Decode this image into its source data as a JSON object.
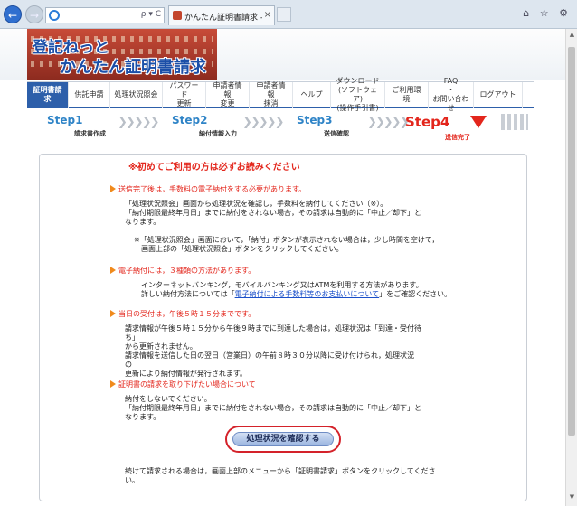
{
  "browser": {
    "tab_title": "かんたん証明書請求 - 送信...",
    "close_glyph": "×",
    "right_icons": "⌂ ☆ ⚙",
    "back_glyph": "←",
    "fwd_glyph": "→",
    "addr_tools": "ρ ▾ C"
  },
  "header": {
    "logo_line1": "登記ねっと",
    "logo_line2": "かんたん証明書請求"
  },
  "menu": [
    {
      "label": "証明書請求",
      "active": true
    },
    {
      "label": "供託申請"
    },
    {
      "label": "処理状況照会"
    },
    {
      "label": "パスワード\n更新"
    },
    {
      "label": "申請者情報\n変更"
    },
    {
      "label": "申請者情報\n抹消"
    },
    {
      "label": "ヘルプ"
    },
    {
      "label": "ダウンロード\n(ソフトウェア)\n(操作手引書)"
    },
    {
      "label": "ご利用環境"
    },
    {
      "label": "FAQ\n・\nお問い合わせ"
    },
    {
      "label": "ログアウト"
    }
  ],
  "steps": {
    "s1_num": "Step1",
    "s1_label": "請求書作成",
    "s2_num": "Step2",
    "s2_label": "納付情報入力",
    "s3_num": "Step3",
    "s3_label": "送信確認",
    "s4_num": "Step4",
    "s4_label": "送信完了"
  },
  "content": {
    "heading": "※初めてご利用の方は必ずお読みください",
    "sec1": "送信完了後は，手数料の電子納付をする必要があります。",
    "p1": "「処理状況照会」画面から処理状況を確認し，手数料を納付してください（※）。\n「納付期限最終年月日」までに納付をされない場合，その請求は自動的に「中止／却下」と\nなります。",
    "p2": "※「処理状況照会」画面において，「納付」ボタンが表示されない場合は，少し時間を空けて，\n　画面上部の「処理状況照会」ボタンをクリックしてください。",
    "sec2": "電子納付には，３種類の方法があります。",
    "p3a": "インターネットバンキング，モバイルバンキング又はATMを利用する方法があります。",
    "p3b_pre": "詳しい納付方法については「",
    "p3b_link": "電子納付による手数料等のお支払いについて",
    "p3b_post": "」をご確認ください。",
    "sec3": "当日の受付は，午後５時１５分までです。",
    "p4": "請求情報が午後５時１５分から午後９時までに到達した場合は，処理状況は「到達・受付待\nち」\nから更新されません。\n請求情報を送信した日の翌日（営業日）の午前８時３０分以降に受け付けられ，処理状況\nの\n更新により納付情報が発行されます。",
    "sec4": "証明書の請求を取り下げたい場合について",
    "p5": "納付をしないでください。\n「納付期限最終年月日」までに納付をされない場合，その請求は自動的に「中止／却下」と\nなります。",
    "cta": "処理状況を確認する",
    "footer": "続けて請求される場合は，画面上部のメニューから「証明書請求」ボタンをクリックしてくださ\nい。"
  }
}
